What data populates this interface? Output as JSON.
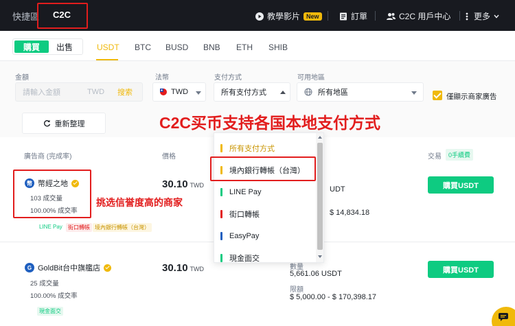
{
  "nav": {
    "brand": "快捷區",
    "c2c": "C2C",
    "tutorial": "教學影片",
    "new_badge": "New",
    "orders": "訂單",
    "user_center": "C2C 用戶中心",
    "more": "更多"
  },
  "tabs": {
    "buy": "購買",
    "sell": "出售",
    "coins": [
      "USDT",
      "BTC",
      "BUSD",
      "BNB",
      "ETH",
      "SHIB"
    ]
  },
  "filters": {
    "amount_label": "金額",
    "amount_placeholder": "請輸入金額",
    "amount_unit": "TWD",
    "search": "搜索",
    "fiat_label": "法幣",
    "fiat_value": "TWD",
    "payment_label": "支付方式",
    "payment_value": "所有支付方式",
    "region_label": "可用地區",
    "region_value": "所有地區",
    "merchant_only": "僅顯示商家廣告",
    "reset": "重新整理"
  },
  "table": {
    "col_advertiser": "廣告商 (完成率)",
    "col_price": "價格",
    "col_trade": "交易",
    "zero_fee": "0手續費"
  },
  "rows": [
    {
      "name": "幣經之地",
      "orders": "103 成交量",
      "completion": "100.00% 成交率",
      "tags": [
        "LINE Pay",
        "街口轉帳",
        "境內銀行轉帳（台灣）"
      ],
      "price": "30.10",
      "currency": "TWD",
      "available_partial": "UDT",
      "limit": "$ 14,834.18",
      "button": "購買USDT"
    },
    {
      "name": "GoldBit台中旗艦店",
      "orders": "25 成交量",
      "completion": "100.00% 成交率",
      "tags": [
        "現金面交"
      ],
      "price": "30.10",
      "currency": "TWD",
      "available_label": "數量",
      "available": "5,661.06 USDT",
      "limit_label": "限額",
      "limit": "$ 5,000.00 - $ 170,398.17",
      "button": "購買USDT"
    }
  ],
  "dropdown": {
    "items": [
      {
        "label": "所有支付方式",
        "color": "#f0b90b"
      },
      {
        "label": "境內銀行轉帳（台灣）",
        "color": "#f0b90b"
      },
      {
        "label": "LINE Pay",
        "color": "#0ecb81"
      },
      {
        "label": "街口轉帳",
        "color": "#e21d1d"
      },
      {
        "label": "EasyPay",
        "color": "#1f5fbf"
      },
      {
        "label": "現金面交",
        "color": "#0ecb81"
      }
    ]
  },
  "annotations": {
    "headline": "C2C买币支持各国本地支付方式",
    "merchant_tip": "挑选信誉度高的商家"
  }
}
